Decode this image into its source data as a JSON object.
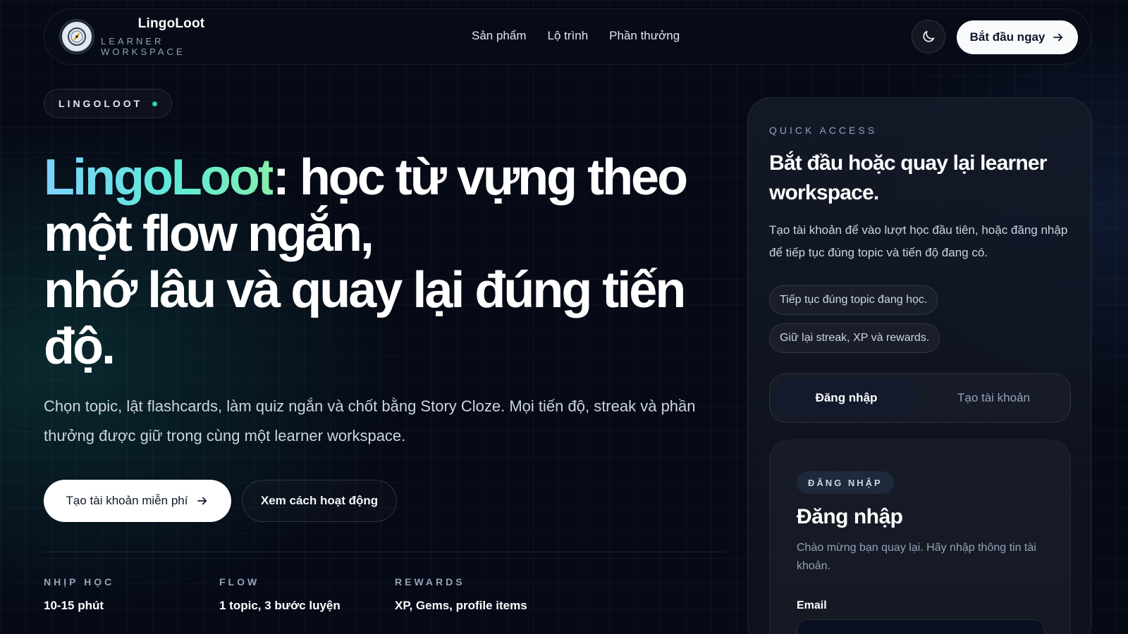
{
  "nav": {
    "brand_name": "LingoLoot",
    "brand_sub": "LEARNER WORKSPACE",
    "links": [
      "Sản phẩm",
      "Lộ trình",
      "Phần thưởng"
    ],
    "start_label": "Bắt đầu ngay"
  },
  "hero": {
    "pill": "LINGOLOOT",
    "title_highlight": "LingoLoot",
    "title_rest": ": học từ vựng theo một flow ngắn,",
    "title_line2": "nhớ lâu và quay lại đúng tiến độ.",
    "description": "Chọn topic, lật flashcards, làm quiz ngắn và chốt bằng Story Cloze. Mọi tiến độ, streak và phần thưởng được giữ trong cùng một learner workspace.",
    "cta_primary": "Tạo tài khoản miễn phí",
    "cta_secondary": "Xem cách hoạt động",
    "stats": [
      {
        "label": "NHỊP HỌC",
        "value": "10-15 phút"
      },
      {
        "label": "FLOW",
        "value": "1 topic, 3 bước luyện"
      },
      {
        "label": "REWARDS",
        "value": "XP, Gems, profile items"
      }
    ]
  },
  "panel": {
    "label": "QUICK ACCESS",
    "title": "Bắt đầu hoặc quay lại learner workspace.",
    "description": "Tạo tài khoản để vào lượt học đầu tiên, hoặc đăng nhập để tiếp tục đúng topic và tiến độ đang có.",
    "chips": [
      "Tiếp tục đúng topic đang học.",
      "Giữ lại streak, XP và rewards."
    ],
    "tabs": [
      "Đăng nhập",
      "Tạo tài khoản"
    ],
    "form": {
      "badge": "ĐĂNG NHẬP",
      "title": "Đăng nhập",
      "description": "Chào mừng bạn quay lại. Hãy nhập thông tin tài khoản.",
      "email_label": "Email"
    }
  },
  "colors": {
    "accent_start": "#7dd3fc",
    "accent_end": "#86efac",
    "status_dot": "#34d399",
    "background": "#060a16"
  }
}
